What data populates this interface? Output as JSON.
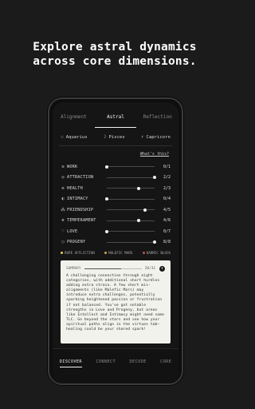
{
  "headline": {
    "line1": "Explore astral dynamics",
    "line2": "across core dimensions."
  },
  "tabs": [
    {
      "label": "Alignment",
      "active": false
    },
    {
      "label": "Astral",
      "active": true
    },
    {
      "label": "Reflection",
      "active": false
    }
  ],
  "signs": [
    {
      "glyph": "☉",
      "label": "Aquarius"
    },
    {
      "glyph": "☽",
      "label": "Pisces"
    },
    {
      "glyph": "↑",
      "label": "Capricorn"
    }
  ],
  "whats_this": "What's this?",
  "dimensions": [
    {
      "icon": "≡",
      "icon_name": "lines-icon",
      "label": "WORK",
      "value": "0/1",
      "level": 0.0
    },
    {
      "icon": "◎",
      "icon_name": "attraction-icon",
      "label": "ATTRACTION",
      "value": "2/2",
      "level": 1.0
    },
    {
      "icon": "⊕",
      "icon_name": "health-icon",
      "label": "HEALTH",
      "value": "2/3",
      "level": 0.67
    },
    {
      "icon": "◐",
      "icon_name": "intimacy-icon",
      "label": "INTIMACY",
      "value": "0/4",
      "level": 0.0
    },
    {
      "icon": "⁂",
      "icon_name": "friendship-icon",
      "label": "FRIENDSHIP",
      "value": "4/5",
      "level": 0.8
    },
    {
      "icon": "⊛",
      "icon_name": "temperament-icon",
      "label": "TEMPERAMENT",
      "value": "4/6",
      "level": 0.67
    },
    {
      "icon": "♡",
      "icon_name": "love-icon",
      "label": "LOVE",
      "value": "0/7",
      "level": 0.0
    },
    {
      "icon": "◯",
      "icon_name": "progeny-icon",
      "label": "PROGENY",
      "value": "8/8",
      "level": 1.0
    }
  ],
  "legend": [
    {
      "label": "ROPE AFFLICTION",
      "color": "#e8d24a"
    },
    {
      "label": "MALEFIC MARS",
      "color": "#e0a340"
    },
    {
      "label": "KARMIC BLOCK",
      "color": "#d94a3a"
    }
  ],
  "summary": {
    "label": "SUMMARY",
    "count": "20/31",
    "progress": 0.65,
    "icon": "✦",
    "text": "A challenging connection through eight categories, with additional short hurdles adding extra strain. A few short mis-alignments (like Malefic Mars) may introduce extra challenges, potentially sparking heightened passion or frustration if not balanced. You've got notable strengths in Love and Progeny, but areas like Intellect and Intimacy might need some TLC. Go beyond the stars and see how your spiritual paths align in the virtues tab—healing could be your shared spark!"
  },
  "bottom_nav": [
    {
      "label": "DISCOVER",
      "active": true
    },
    {
      "label": "CONNECT",
      "active": false
    },
    {
      "label": "DECODE",
      "active": false
    },
    {
      "label": "CORE",
      "active": false
    }
  ]
}
